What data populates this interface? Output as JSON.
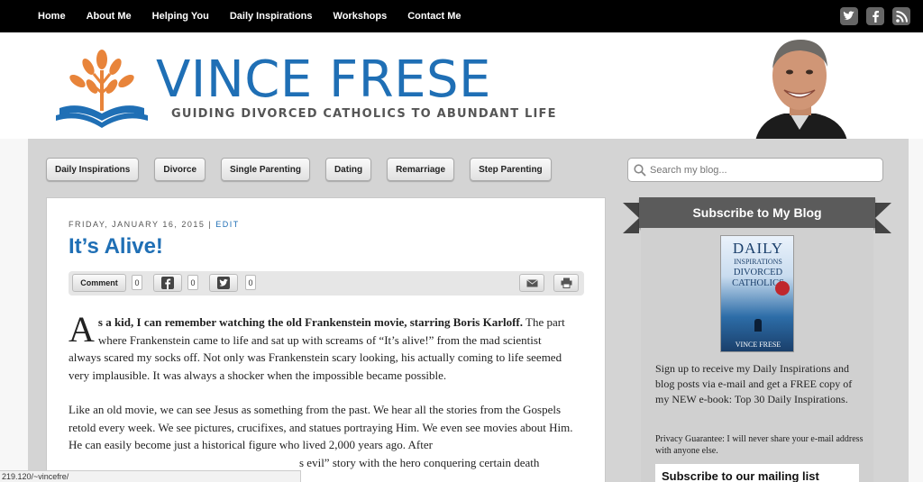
{
  "nav": {
    "items": [
      "Home",
      "About Me",
      "Helping You",
      "Daily Inspirations",
      "Workshops",
      "Contact Me"
    ]
  },
  "social": [
    "twitter-icon",
    "facebook-icon",
    "rss-icon"
  ],
  "header": {
    "title": "VINCE FRESE",
    "tagline": "GUIDING DIVORCED CATHOLICS TO ABUNDANT LIFE"
  },
  "categories": [
    "Daily Inspirations",
    "Divorce",
    "Single Parenting",
    "Dating",
    "Remarriage",
    "Step Parenting"
  ],
  "search": {
    "placeholder": "Search my blog..."
  },
  "post": {
    "date": "FRIDAY, JANUARY 16, 2015",
    "separator": "|",
    "edit": "EDIT",
    "title": "It’s Alive!",
    "share": {
      "comment_label": "Comment",
      "comment_count": "0",
      "facebook_count": "0",
      "twitter_count": "0"
    },
    "dropcap": "A",
    "lead": "s a kid, I can remember watching the old Frankenstein movie, starring Boris Karloff.",
    "para1_rest": " The part where Frankenstein came to life and sat up with screams of “It’s alive!” from the mad scientist always scared my socks off. Not only was Frankenstein scary looking, his actually coming to life seemed very implausible. It was always a shocker when the impossible became possible.",
    "para2": "Like an old movie, we can see Jesus as something from the past. We hear all the stories from the Gospels retold every week. We see pictures, crucifixes, and statues portraying Him. We even see movies about Him. He can easily become just a historical figure who lived 2,000 years ago. After",
    "para3_fragment": "s evil” story with the hero conquering certain death"
  },
  "sidebar": {
    "ribbon": "Subscribe to My Blog",
    "book": {
      "line1": "DAILY",
      "line2": "INSPIRATIONS",
      "line3": "DIVORCED",
      "line4": "CATHOLICS",
      "author": "VINCE FRESE"
    },
    "signup_text": "Sign up to receive my Daily Inspirations and blog posts via e-mail and get a FREE copy of my NEW e-book: Top 30 Daily Inspirations.",
    "privacy": "Privacy Guarantee: I will never share your e-mail address with anyone else.",
    "mailing_title": "Subscribe to our mailing list"
  },
  "statusbar": {
    "url": "219.120/~vincefre/"
  },
  "colors": {
    "accent": "#1f6fb5",
    "orange": "#e8843a",
    "topbar": "#000000"
  }
}
